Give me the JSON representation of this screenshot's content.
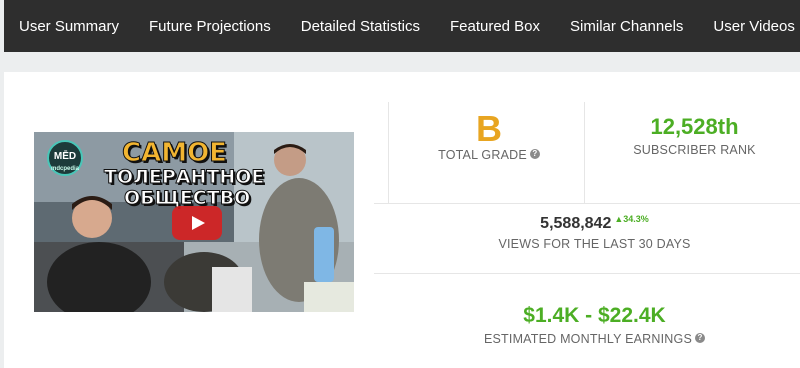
{
  "nav": {
    "items": [
      {
        "label": "User Summary"
      },
      {
        "label": "Future Projections"
      },
      {
        "label": "Detailed Statistics"
      },
      {
        "label": "Featured Box"
      },
      {
        "label": "Similar Channels"
      },
      {
        "label": "User Videos"
      }
    ]
  },
  "video": {
    "logo_text": "MĒD",
    "logo_sub": "mdcpedia",
    "title_line1": "САМОЕ",
    "title_line2": "ТОЛЕРАНТНОЕ",
    "title_line3": "ОБЩЕСТВО"
  },
  "stats": {
    "grade": {
      "value": "B",
      "label": "TOTAL GRADE",
      "help_icon": "?"
    },
    "rank": {
      "value": "12,528th",
      "label": "SUBSCRIBER RANK"
    },
    "views": {
      "value": "5,588,842",
      "change": "34.3%",
      "change_arrow": "▲",
      "label": "VIEWS FOR THE LAST 30 DAYS"
    },
    "earnings": {
      "value": "$1.4K - $22.4K",
      "label": "ESTIMATED MONTHLY EARNINGS",
      "help_icon": "?"
    }
  },
  "colors": {
    "nav_bg": "#2e2e2e",
    "grade": "#e8a521",
    "positive": "#4cae24",
    "label": "#666666"
  }
}
